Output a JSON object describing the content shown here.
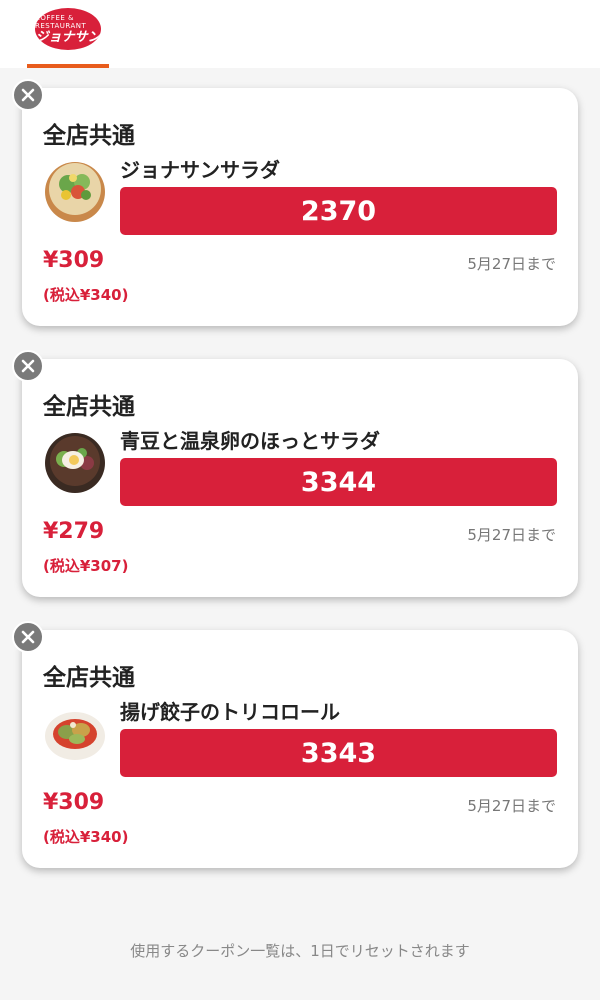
{
  "header": {
    "logo_top_text": "COFFEE & RESTAURANT",
    "logo_main_text": "ジョナサン"
  },
  "coupons": [
    {
      "title": "全店共通",
      "item_name": "ジョナサンサラダ",
      "code": "2370",
      "price": "¥309",
      "price_tax": "(税込¥340)",
      "expiry": "5月27日まで",
      "image_icon": "salad-bowl-icon"
    },
    {
      "title": "全店共通",
      "item_name": "青豆と温泉卵のほっとサラダ",
      "code": "3344",
      "price": "¥279",
      "price_tax": "(税込¥307)",
      "expiry": "5月27日まで",
      "image_icon": "egg-salad-bowl-icon"
    },
    {
      "title": "全店共通",
      "item_name": "揚げ餃子のトリコロール",
      "code": "3343",
      "price": "¥309",
      "price_tax": "(税込¥340)",
      "expiry": "5月27日まで",
      "image_icon": "fried-gyoza-plate-icon"
    }
  ],
  "footer": {
    "note": "使用するクーポン一覧は、1日でリセットされます"
  },
  "colors": {
    "brand_red": "#d8203a",
    "tab_accent": "#e85c1c",
    "close_gray": "#7a7a7a"
  }
}
